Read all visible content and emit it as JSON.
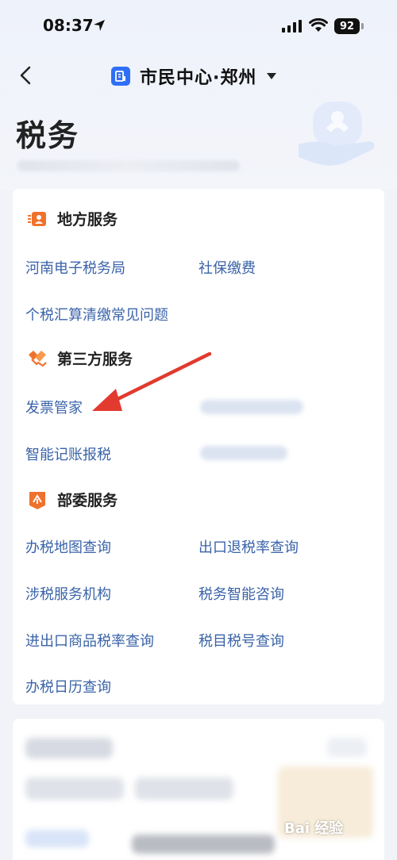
{
  "status_bar": {
    "time": "08:37",
    "battery": "92"
  },
  "nav": {
    "title": "市民中心·郑州"
  },
  "page": {
    "title": "税务"
  },
  "sections": {
    "local": {
      "title": "地方服务",
      "items": [
        "河南电子税务局",
        "社保缴费",
        "个税汇算清缴常见问题"
      ]
    },
    "third_party": {
      "title": "第三方服务",
      "items": [
        "发票管家",
        "智能记账报税"
      ]
    },
    "ministry": {
      "title": "部委服务",
      "items": [
        "办税地图查询",
        "出口退税率查询",
        "涉税服务机构",
        "税务智能咨询",
        "进出口商品税率查询",
        "税目税号查询",
        "办税日历查询"
      ]
    }
  },
  "watermark": "Bai 经验",
  "colors": {
    "link": "#3a63a8",
    "accent_orange": "#f0712c",
    "accent_blue": "#2f6ff5",
    "annotation_red": "#e23a2e"
  }
}
